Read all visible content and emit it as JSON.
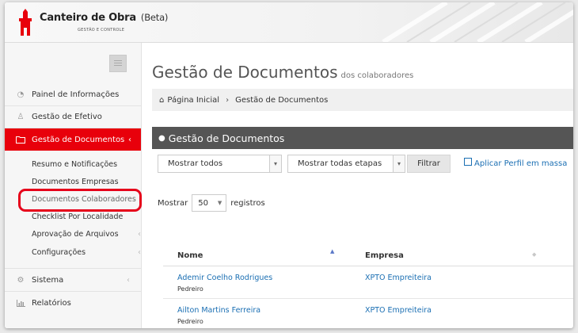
{
  "brand": {
    "name": "Canteiro de Obra",
    "beta": "(Beta)",
    "tagline": "GESTÃO E CONTROLE"
  },
  "sidebar": {
    "items": [
      {
        "label": "Painel de Informações",
        "icon": "dashboard-icon"
      },
      {
        "label": "Gestão de Efetivo",
        "icon": "person-icon"
      },
      {
        "label": "Gestão de Documentos",
        "icon": "folder-icon",
        "active": true,
        "chevron": "‹"
      },
      {
        "label": "Sistema",
        "icon": "cogs-icon",
        "chevron": "‹"
      },
      {
        "label": "Relatórios",
        "icon": "bar-chart-icon"
      }
    ],
    "subitems": [
      {
        "label": "Resumo e Notificações"
      },
      {
        "label": "Documentos Empresas"
      },
      {
        "label": "Documentos Colaboradores"
      },
      {
        "label": "Checklist Por Localidade"
      },
      {
        "label": "Aprovação de Arquivos",
        "chevron": "‹"
      },
      {
        "label": "Configurações",
        "chevron": "‹"
      }
    ]
  },
  "main": {
    "title": "Gestão de Documentos",
    "subtitle": "dos colaboradores",
    "breadcrumb": {
      "home": "Página Inicial",
      "sep": "›",
      "current": "Gestão de Documentos"
    },
    "panel_title": "Gestão de Documentos",
    "filters": {
      "select1": "Mostrar todos",
      "select2": "Mostrar todas etapas",
      "filter_button": "Filtrar",
      "mass_profile": "Aplicar Perfil em massa"
    },
    "length": {
      "prefix": "Mostrar",
      "value": "50",
      "suffix": "registros"
    },
    "table": {
      "columns": [
        "Nome",
        "Empresa"
      ],
      "rows": [
        {
          "name": "Ademir Coelho Rodrigues",
          "role": "Pedreiro",
          "company": "XPTO Empreiteira",
          "edge": "C"
        },
        {
          "name": "Ailton Martins Ferreira",
          "role": "Pedreiro",
          "company": "XPTO Empreiteira",
          "edge": "C"
        }
      ]
    }
  },
  "colors": {
    "accent": "#e8000b",
    "link": "#1b6fb3",
    "panel_header": "#555555"
  }
}
